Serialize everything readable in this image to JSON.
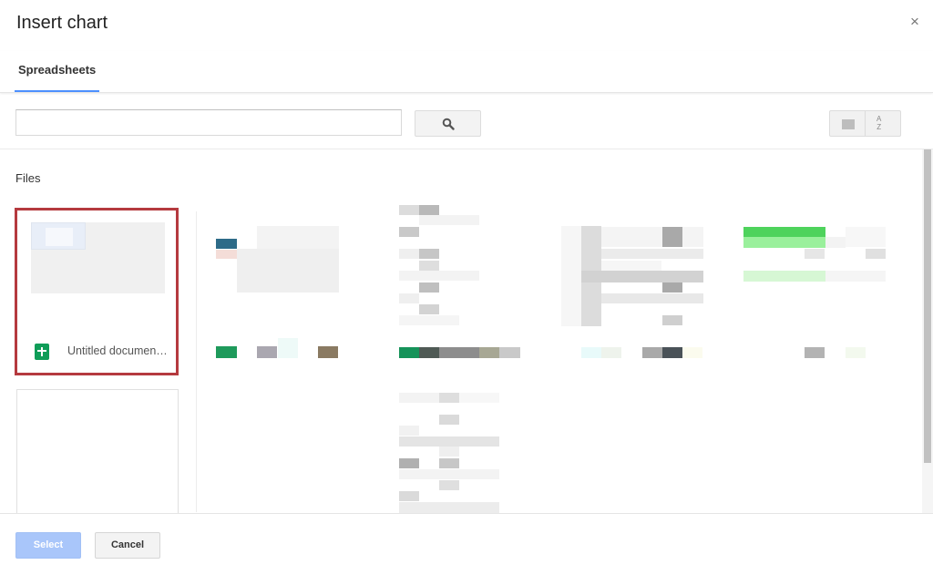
{
  "dialog": {
    "title": "Insert chart",
    "close_symbol": "×"
  },
  "tabs": [
    {
      "label": "Spreadsheets",
      "active": true
    }
  ],
  "toolbar": {
    "search_value": "",
    "search_placeholder": "",
    "search_icon": "magnifier-icon",
    "view_icon": "grid-view-icon",
    "sort_icon": "sort-az-icon",
    "sort_label_top": "A",
    "sort_label_bottom": "Z"
  },
  "files": {
    "section_label": "Files",
    "items": [
      {
        "name": "Untitled documen…",
        "type_icon": "google-sheets-icon",
        "selected": true
      },
      {
        "name": "",
        "selected": false
      }
    ]
  },
  "footer": {
    "select_label": "Select",
    "cancel_label": "Cancel"
  },
  "colors": {
    "accent": "#4d90fe",
    "selection_border": "#b53a3f",
    "sheets_green": "#0f9d58",
    "select_button_disabled": "#a9c6fa"
  }
}
